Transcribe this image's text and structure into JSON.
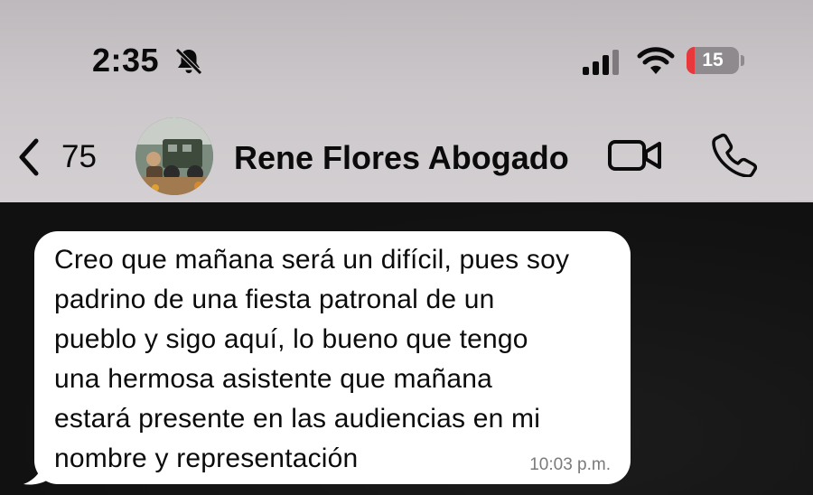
{
  "status_bar": {
    "time": "2:35",
    "battery_percent": "15",
    "battery_level": 0.15,
    "icons": [
      "bell-slash-icon",
      "cellular-signal-icon",
      "wifi-icon",
      "battery-icon"
    ]
  },
  "nav": {
    "back_count": "75",
    "contact_name": "Rene Flores Abogado",
    "icons": [
      "chevron-left-icon",
      "video-camera-icon",
      "phone-icon"
    ]
  },
  "messages": [
    {
      "direction": "incoming",
      "text": "Creo que mañana será un difícil, pues soy\npadrino de una fiesta patronal de un\npueblo y sigo aquí, lo bueno que tengo\nuna hermosa asistente que mañana\nestará presente en las audiencias en mi\nnombre y representación",
      "time": "10:03 p.m."
    }
  ],
  "colors": {
    "header_bg": "#c9c5c8",
    "chat_bg": "#141414",
    "bubble_bg": "#ffffff",
    "battery_low": "#e8383b"
  }
}
